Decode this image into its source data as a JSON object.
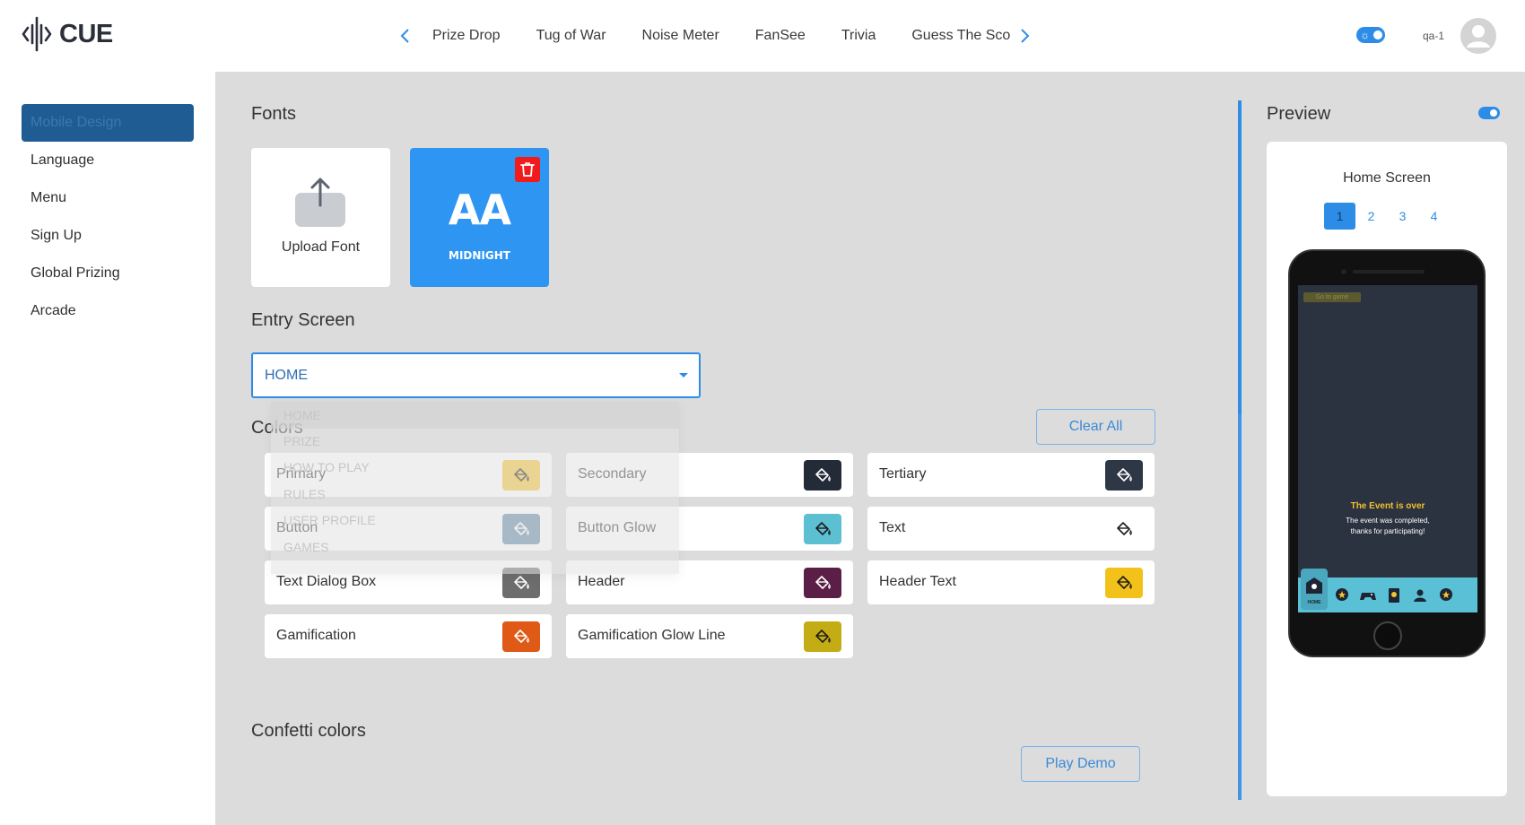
{
  "app": {
    "logo_text": "CUE"
  },
  "header": {
    "tabs": [
      {
        "label": "Prize Drop"
      },
      {
        "label": "Tug of War"
      },
      {
        "label": "Noise Meter"
      },
      {
        "label": "FanSee"
      },
      {
        "label": "Trivia"
      },
      {
        "label": "Guess The Sco"
      }
    ],
    "user_name": "qa-1"
  },
  "sidebar": {
    "items": [
      {
        "label": "Mobile Design"
      },
      {
        "label": "Language"
      },
      {
        "label": "Menu"
      },
      {
        "label": "Sign Up"
      },
      {
        "label": "Global Prizing"
      },
      {
        "label": "Arcade"
      }
    ]
  },
  "fonts": {
    "title": "Fonts",
    "upload_label": "Upload Font",
    "selected_font_preview": "AA",
    "selected_font_name": "MIDNIGHT"
  },
  "entry_screen": {
    "title": "Entry Screen",
    "value": "HOME",
    "options": [
      "HOME",
      "PRIZE",
      "HOW TO PLAY",
      "RULES",
      "USER PROFILE",
      "GAMES"
    ]
  },
  "colors": {
    "title": "Colors",
    "clear_all_label": "Clear All",
    "items": [
      {
        "label": "Primary",
        "color": "#f2c42f",
        "icon": "paint-bucket-icon"
      },
      {
        "label": "Secondary",
        "color": "#232b38",
        "icon": "paint-bucket-icon"
      },
      {
        "label": "Tertiary",
        "color": "#2e3746",
        "icon": "paint-bucket-icon"
      },
      {
        "label": "Button",
        "color": "#5f87a4",
        "icon": "paint-bucket-icon"
      },
      {
        "label": "Button Glow",
        "color": "#5cbfd2",
        "icon": "paint-bucket-icon"
      },
      {
        "label": "Text",
        "color": "#ffffff",
        "icon": "paint-bucket-icon"
      },
      {
        "label": "Text Dialog Box",
        "color": "#6d6d6d",
        "icon": "paint-bucket-icon"
      },
      {
        "label": "Header",
        "color": "#5b1f47",
        "icon": "paint-bucket-icon"
      },
      {
        "label": "Header Text",
        "color": "#f2c21a",
        "icon": "paint-bucket-icon"
      },
      {
        "label": "Gamification",
        "color": "#de5a16",
        "icon": "paint-bucket-icon"
      },
      {
        "label": "Gamification Glow Line",
        "color": "#c4ad14",
        "icon": "paint-bucket-icon"
      }
    ]
  },
  "confetti": {
    "title": "Confetti colors",
    "play_demo_label": "Play Demo"
  },
  "preview": {
    "title": "Preview",
    "screen_name": "Home Screen",
    "pages": [
      "1",
      "2",
      "3",
      "4"
    ],
    "active_page": "1",
    "goto_label": "Go to game",
    "event_title": "The Event is over",
    "event_message_1": "The event was completed,",
    "event_message_2": "thanks for participating!",
    "nav_home_label": "HOME"
  }
}
